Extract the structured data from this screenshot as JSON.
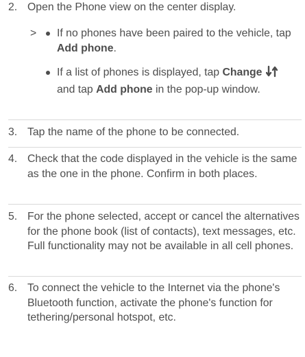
{
  "step2": {
    "number": "2.",
    "text": "Open the Phone view on the center display.",
    "arrow": ">",
    "bullet1": {
      "before": "If no phones have been paired to the vehicle, tap ",
      "bold": "Add phone",
      "after": "."
    },
    "bullet2": {
      "before": "If a list of phones is displayed, tap ",
      "bold1": "Change",
      "icon": "swap-arrows-icon",
      "middle": "and tap ",
      "bold2": "Add phone",
      "after": " in the pop-up window."
    }
  },
  "step3": {
    "number": "3.",
    "text": "Tap the name of the phone to be connected."
  },
  "step4": {
    "number": "4.",
    "text": "Check that the code displayed in the vehicle is the same as the one in the phone. Confirm in both places."
  },
  "step5": {
    "number": "5.",
    "text": "For the phone selected, accept or cancel the alternatives for the phone book (list of contacts), text messages, etc. Full functionality may not be available in all cell phones."
  },
  "step6": {
    "number": "6.",
    "text": "To connect the vehicle to the Internet via the phone's Bluetooth function, activate the phone's function for tethering/personal hotspot, etc."
  },
  "colors": {
    "text": "#4d4d4d",
    "separator": "#d9d9d9"
  }
}
